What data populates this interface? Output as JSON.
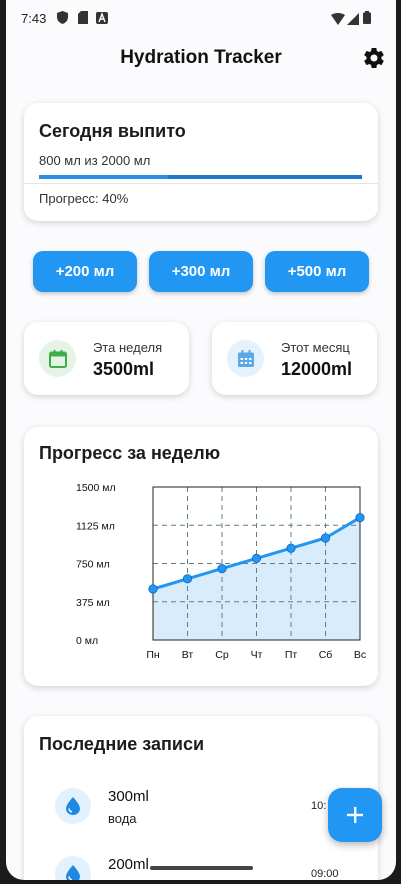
{
  "status_bar": {
    "time": "7:43"
  },
  "app": {
    "title": "Hydration Tracker",
    "settings_icon": "gear-icon"
  },
  "today": {
    "title": "Сегодня выпито",
    "summary": "800 мл из 2000 мл",
    "progress_fraction": 0.4,
    "progress_text": "Прогресс: 40%"
  },
  "quick_add": [
    {
      "label": "+200 мл"
    },
    {
      "label": "+300 мл"
    },
    {
      "label": "+500 мл"
    }
  ],
  "stats": {
    "week": {
      "label": "Эта неделя",
      "value": "3500ml",
      "icon": "calendar-icon",
      "color": "#3fae4a"
    },
    "month": {
      "label": "Этот месяц",
      "value": "12000ml",
      "icon": "calendar-month-icon",
      "color": "#5aa9e6"
    }
  },
  "weekly": {
    "title": "Прогресс за неделю"
  },
  "chart_data": {
    "type": "line",
    "title": "Прогресс за неделю",
    "categories": [
      "Пн",
      "Вт",
      "Ср",
      "Чт",
      "Пт",
      "Сб",
      "Вс"
    ],
    "values": [
      500,
      600,
      700,
      800,
      900,
      1000,
      1200
    ],
    "ylim": [
      0,
      1500
    ],
    "ytick_labels": [
      "0 мл",
      "375 мл",
      "750 мл",
      "1125 мл",
      "1500 мл"
    ],
    "yticks": [
      0,
      375,
      750,
      1125,
      1500
    ],
    "grid": true,
    "colors": {
      "line": "#2196f3",
      "area": "#d9ecfb",
      "grid": "#5f7f7f"
    }
  },
  "recent": {
    "title": "Последние записи",
    "entries": [
      {
        "amount": "300ml",
        "kind": "вода",
        "time": "10:"
      },
      {
        "amount": "200ml",
        "kind": "",
        "time": "09:00"
      }
    ]
  },
  "fab": {
    "icon": "plus-icon"
  },
  "colors": {
    "accent": "#2196f3",
    "card": "#ffffff",
    "background": "#fbfbfd"
  }
}
